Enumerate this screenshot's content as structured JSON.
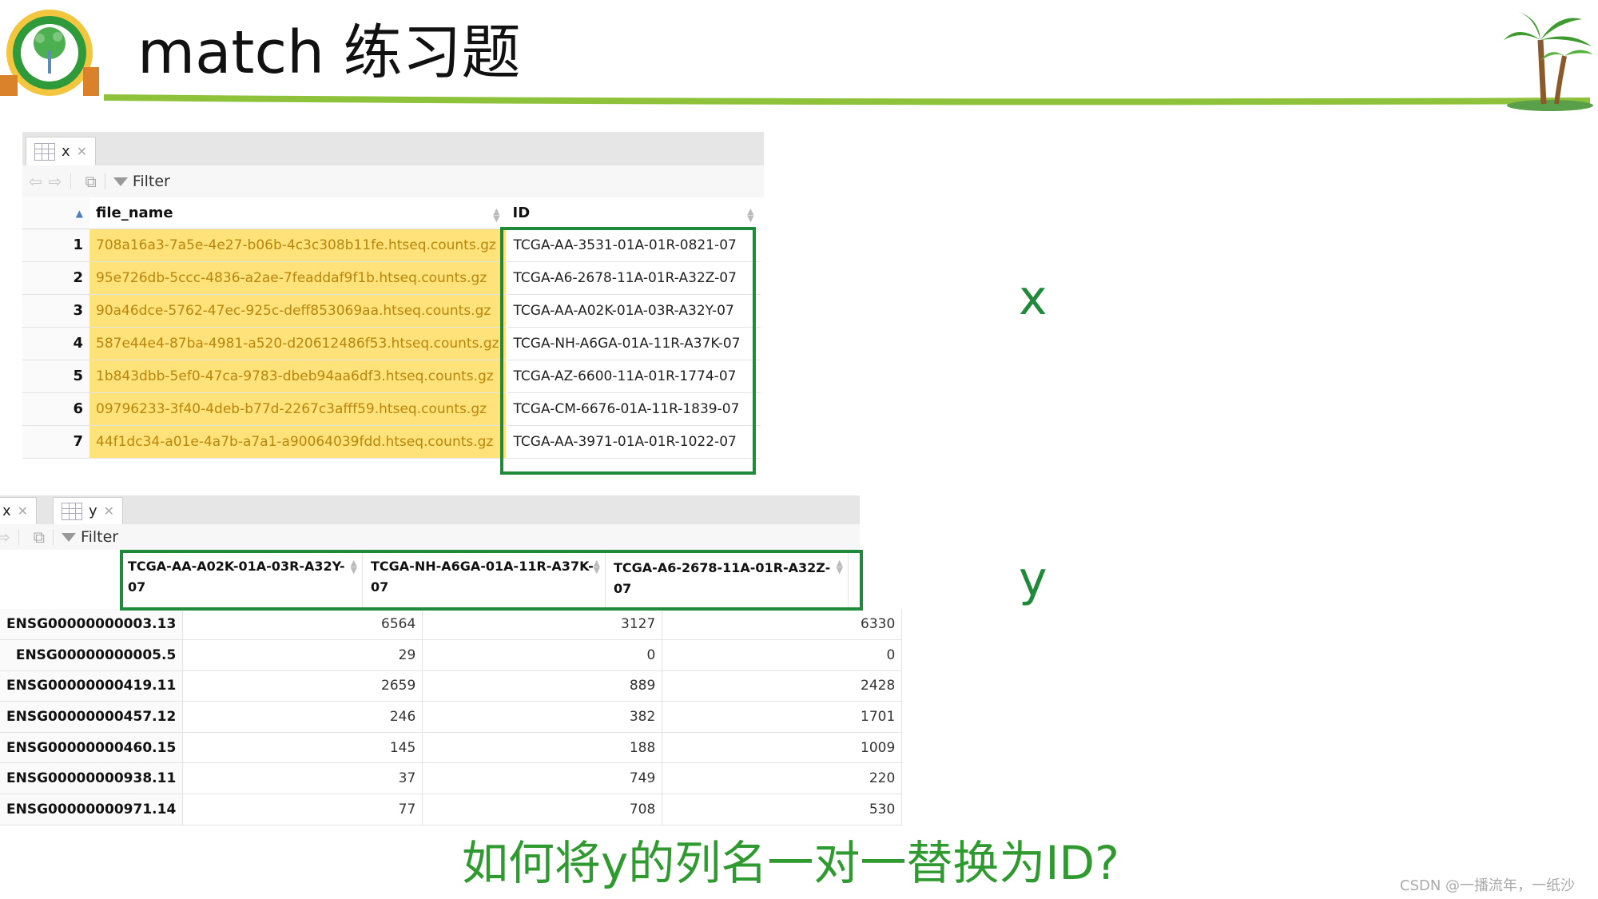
{
  "header": {
    "title": "match 练习题"
  },
  "x_viewer": {
    "tab_label": "x",
    "filter_label": "Filter",
    "columns": [
      "file_name",
      "ID"
    ],
    "rows": [
      {
        "num": "1",
        "file_name": "708a16a3-7a5e-4e27-b06b-4c3c308b11fe.htseq.counts.gz",
        "id": "TCGA-AA-3531-01A-01R-0821-07"
      },
      {
        "num": "2",
        "file_name": "95e726db-5ccc-4836-a2ae-7feaddaf9f1b.htseq.counts.gz",
        "id": "TCGA-A6-2678-11A-01R-A32Z-07"
      },
      {
        "num": "3",
        "file_name": "90a46dce-5762-47ec-925c-deff853069aa.htseq.counts.gz",
        "id": "TCGA-AA-A02K-01A-03R-A32Y-07"
      },
      {
        "num": "4",
        "file_name": "587e44e4-87ba-4981-a520-d20612486f53.htseq.counts.gz",
        "id": "TCGA-NH-A6GA-01A-11R-A37K-07"
      },
      {
        "num": "5",
        "file_name": "1b843dbb-5ef0-47ca-9783-dbeb94aa6df3.htseq.counts.gz",
        "id": "TCGA-AZ-6600-11A-01R-1774-07"
      },
      {
        "num": "6",
        "file_name": "09796233-3f40-4deb-b77d-2267c3afff59.htseq.counts.gz",
        "id": "TCGA-CM-6676-01A-11R-1839-07"
      },
      {
        "num": "7",
        "file_name": "44f1dc34-a01e-4a7b-a7a1-a90064039fdd.htseq.counts.gz",
        "id": "TCGA-AA-3971-01A-01R-1022-07"
      }
    ],
    "var_label": "x"
  },
  "y_viewer": {
    "tab_x_label": "x",
    "tab_y_label": "y",
    "filter_label": "Filter",
    "columns": [
      {
        "line1": "TCGA-AA-A02K-01A-03R-A32Y-",
        "line2": "07"
      },
      {
        "line1": "TCGA-NH-A6GA-01A-11R-A37K-",
        "line2": "07"
      },
      {
        "line1": "TCGA-A6-2678-11A-01R-A32Z-07",
        "line2": ""
      }
    ],
    "rows": [
      {
        "gene": "ENSG00000000003.13",
        "v1": "6564",
        "v2": "3127",
        "v3": "6330"
      },
      {
        "gene": "ENSG00000000005.5",
        "v1": "29",
        "v2": "0",
        "v3": "0"
      },
      {
        "gene": "ENSG00000000419.11",
        "v1": "2659",
        "v2": "889",
        "v3": "2428"
      },
      {
        "gene": "ENSG00000000457.12",
        "v1": "246",
        "v2": "382",
        "v3": "1701"
      },
      {
        "gene": "ENSG00000000460.15",
        "v1": "145",
        "v2": "188",
        "v3": "1009"
      },
      {
        "gene": "ENSG00000000938.11",
        "v1": "37",
        "v2": "749",
        "v3": "220"
      },
      {
        "gene": "ENSG00000000971.14",
        "v1": "77",
        "v2": "708",
        "v3": "530"
      }
    ],
    "var_label": "y"
  },
  "question": "如何将y的列名一对一替换为ID?",
  "watermark": "CSDN @一播流年，一纸沙",
  "colors": {
    "accent_green": "#1f8a3a",
    "highlight_yellow": "#ffe27a",
    "question_green": "#2f9a2f"
  }
}
